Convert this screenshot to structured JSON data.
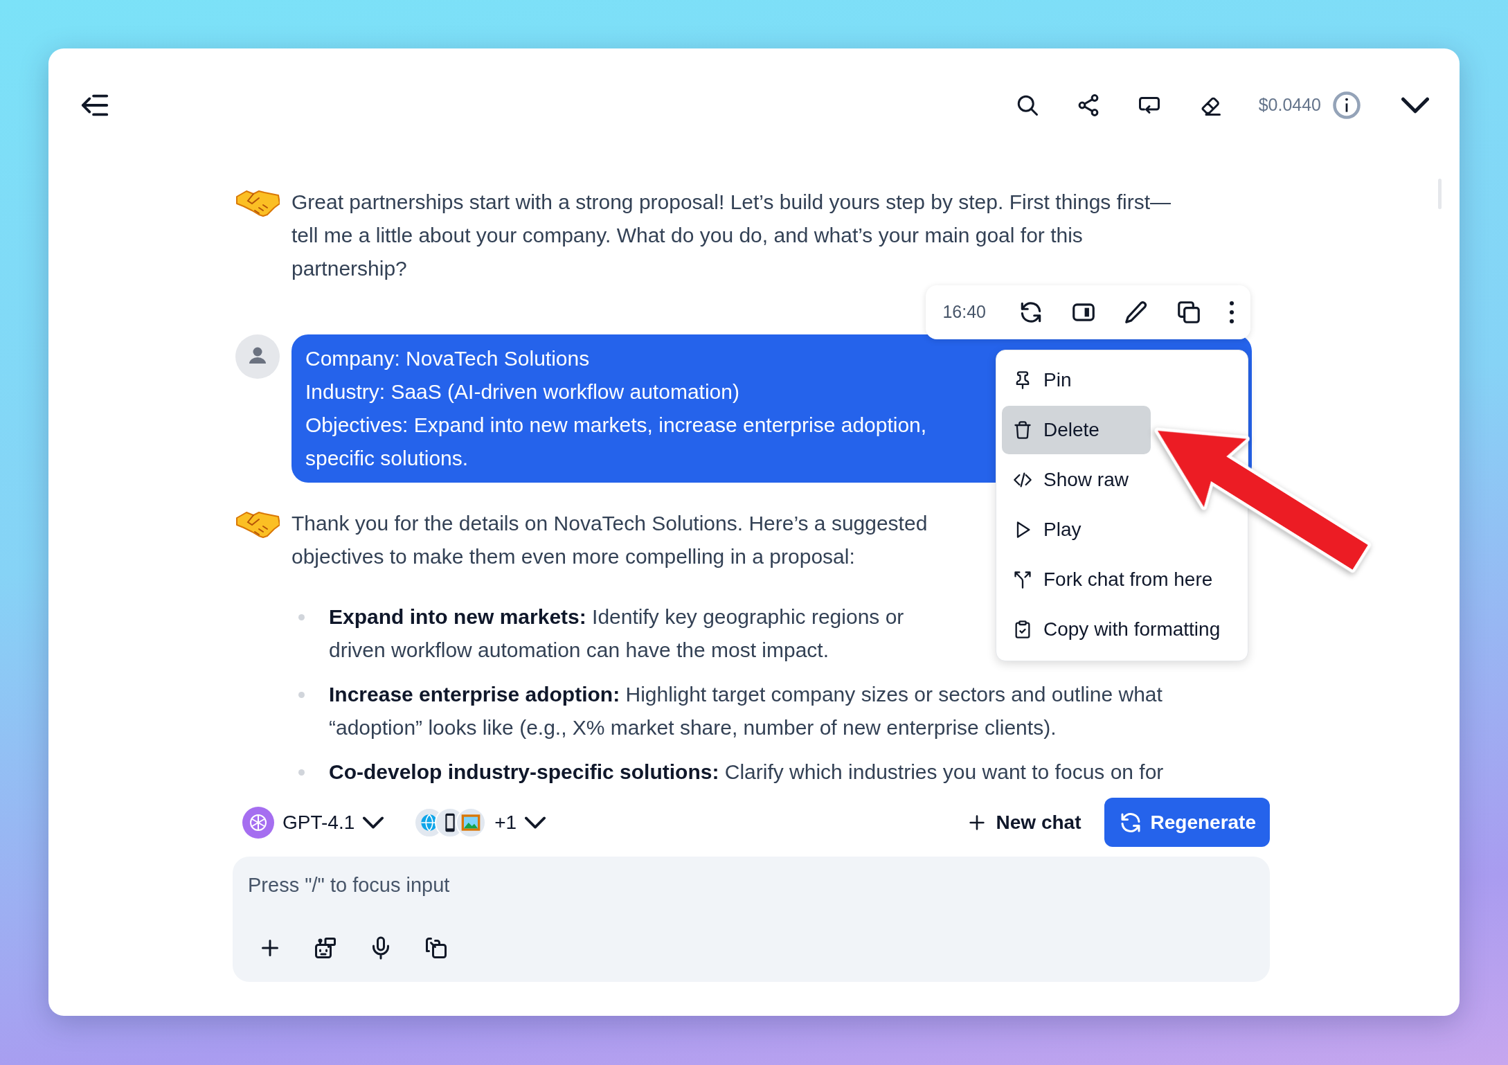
{
  "header": {
    "cost": "$0.0440"
  },
  "messages": [
    {
      "kind": "assistant",
      "lines": [
        "Great partnerships start with a strong proposal! Let’s build yours step by step. First things first—",
        "tell me a little about your company. What do you do, and what’s your main goal for this",
        "partnership?"
      ]
    },
    {
      "kind": "user",
      "time": "16:40",
      "lines": [
        "Company: NovaTech Solutions",
        "Industry: SaaS (AI-driven workflow automation)",
        "Objectives: Expand into new markets, increase enterprise adoption,",
        "specific solutions."
      ]
    },
    {
      "kind": "assistant",
      "lines": [
        "Thank you for the details on NovaTech Solutions. Here’s a suggested",
        "objectives to make them even more compelling in a proposal:"
      ],
      "bullets": [
        {
          "lines": [
            "**Expand into new markets:** Identify key geographic regions or",
            "driven workflow automation can have the most impact."
          ]
        },
        {
          "lines": [
            "**Increase enterprise adoption:** Highlight target company sizes or sectors and outline what",
            "“adoption” looks like (e.g., X% market share, number of new enterprise clients)."
          ]
        },
        {
          "lines": [
            "**Co-develop industry-specific solutions:** Clarify which industries you want to focus on for"
          ]
        }
      ]
    }
  ],
  "message_menu": [
    {
      "label": "Pin",
      "selected": false
    },
    {
      "label": "Delete",
      "selected": true
    },
    {
      "label": "Show raw",
      "selected": false
    },
    {
      "label": "Play",
      "selected": false
    },
    {
      "label": "Fork chat from here",
      "selected": false
    },
    {
      "label": "Copy with formatting",
      "selected": false
    }
  ],
  "composer": {
    "model": "GPT-4.1",
    "tools_more": "+1",
    "new_chat": "New chat",
    "regenerate": "Regenerate",
    "placeholder": "Press \"/\" to focus input"
  }
}
